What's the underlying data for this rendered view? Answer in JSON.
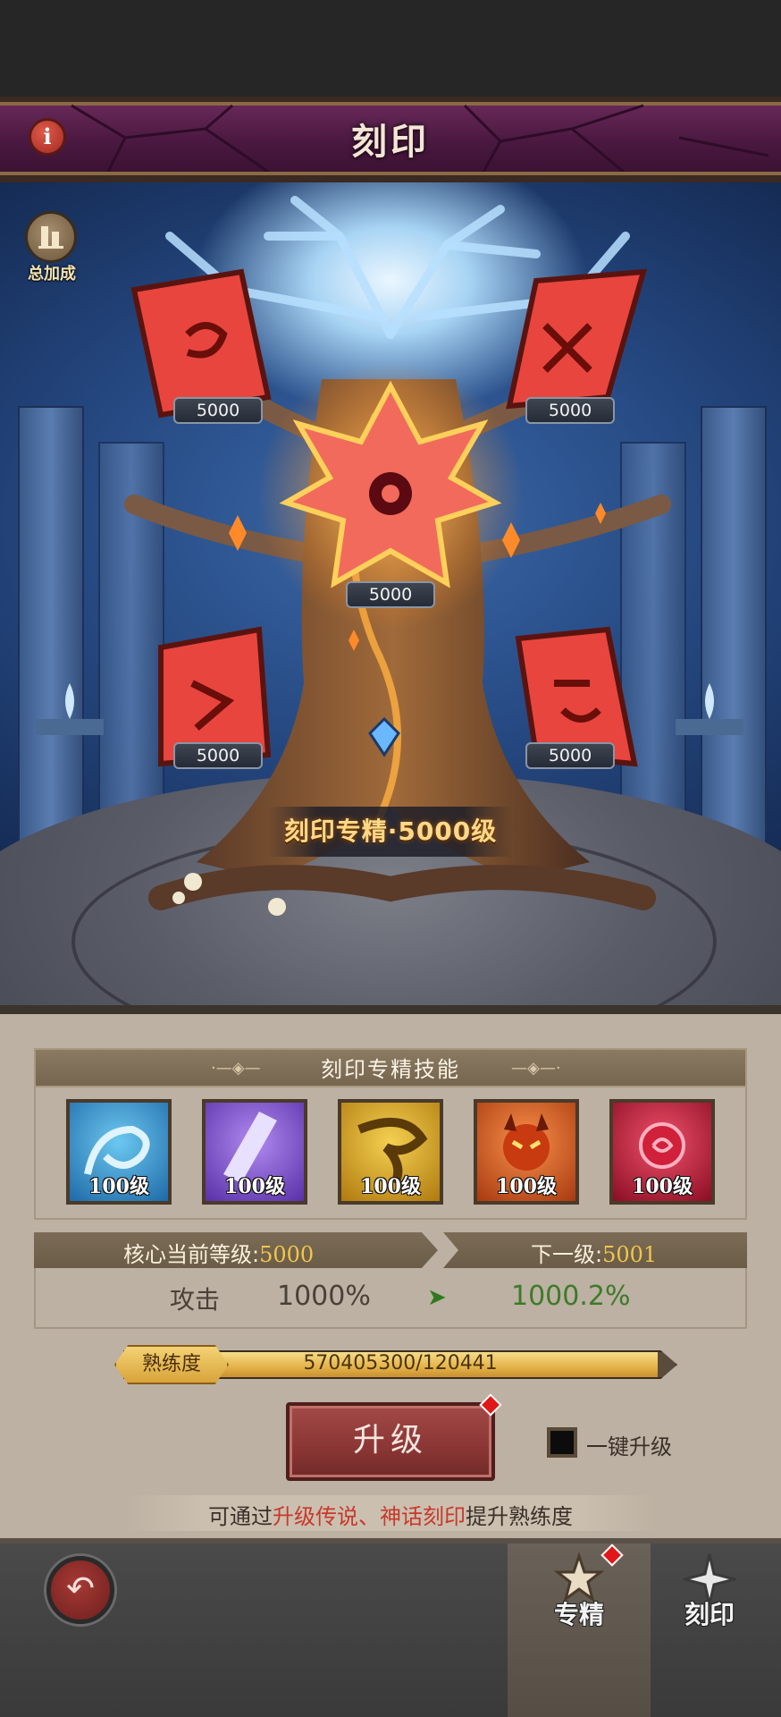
{
  "header": {
    "title": "刻印"
  },
  "scene": {
    "total_bonus_label": "总加成",
    "glyphs": [
      {
        "value": "5000"
      },
      {
        "value": "5000"
      },
      {
        "value": "5000"
      },
      {
        "value": "5000"
      },
      {
        "value": "5000"
      }
    ],
    "mastery_level_banner": "刻印专精·5000级"
  },
  "skills": {
    "title": "刻印专精技能",
    "items": [
      {
        "level": "100级",
        "color": "#2a8fd0"
      },
      {
        "level": "100级",
        "color": "#7a4ad0"
      },
      {
        "level": "100级",
        "color": "#d8a420"
      },
      {
        "level": "100级",
        "color": "#e0582a"
      },
      {
        "level": "100级",
        "color": "#c81e3a"
      }
    ]
  },
  "core_level": {
    "current_label": "核心当前等级:",
    "current_value": "5000",
    "next_label": "下一级:",
    "next_value": "5001"
  },
  "stat": {
    "name": "攻击",
    "current": "1000%",
    "arrow": "➤",
    "next": "1000.2%"
  },
  "proficiency": {
    "label": "熟练度",
    "value_text": "570405300/120441",
    "fill_fraction": 1.0
  },
  "actions": {
    "upgrade_label": "升级",
    "one_key_label": "一键升级"
  },
  "hint": {
    "prefix": "可通过",
    "highlight": "升级传说、神话刻印",
    "suffix": "提升熟练度"
  },
  "nav": {
    "mastery_label": "专精",
    "imprint_label": "刻印"
  },
  "colors": {
    "accent_gold": "#f0c64a",
    "stat_increase_green": "#3e7a2a",
    "badge_red": "#e01818"
  }
}
